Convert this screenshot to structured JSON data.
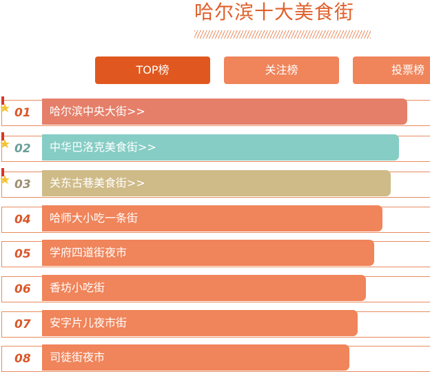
{
  "title": "哈尔滨十大美食街",
  "tabs": [
    {
      "label": "TOP榜",
      "active": true
    },
    {
      "label": "关注榜",
      "active": false
    },
    {
      "label": "投票榜",
      "active": false
    }
  ],
  "items": [
    {
      "rank": "01",
      "name": "哈尔滨中央大街>>",
      "color": "#e57f69",
      "rank_color": "#d9582a",
      "medal": true
    },
    {
      "rank": "02",
      "name": "中华巴洛克美食街>>",
      "color": "#86cdc5",
      "rank_color": "#6a9e9a",
      "medal": true
    },
    {
      "rank": "03",
      "name": "关东古巷美食街>>",
      "color": "#cfbb88",
      "rank_color": "#9d8f6f",
      "medal": true
    },
    {
      "rank": "04",
      "name": "哈师大小吃一条街",
      "color": "#f0845a",
      "rank_color": "#d9582a",
      "medal": false
    },
    {
      "rank": "05",
      "name": "学府四道街夜市",
      "color": "#f0845a",
      "rank_color": "#d9582a",
      "medal": false
    },
    {
      "rank": "06",
      "name": "香坊小吃街",
      "color": "#f0845a",
      "rank_color": "#d9582a",
      "medal": false
    },
    {
      "rank": "07",
      "name": "安字片儿夜市街",
      "color": "#f0845a",
      "rank_color": "#d9582a",
      "medal": false
    },
    {
      "rank": "08",
      "name": "司徒街夜市",
      "color": "#f0845a",
      "rank_color": "#d9582a",
      "medal": false
    }
  ]
}
